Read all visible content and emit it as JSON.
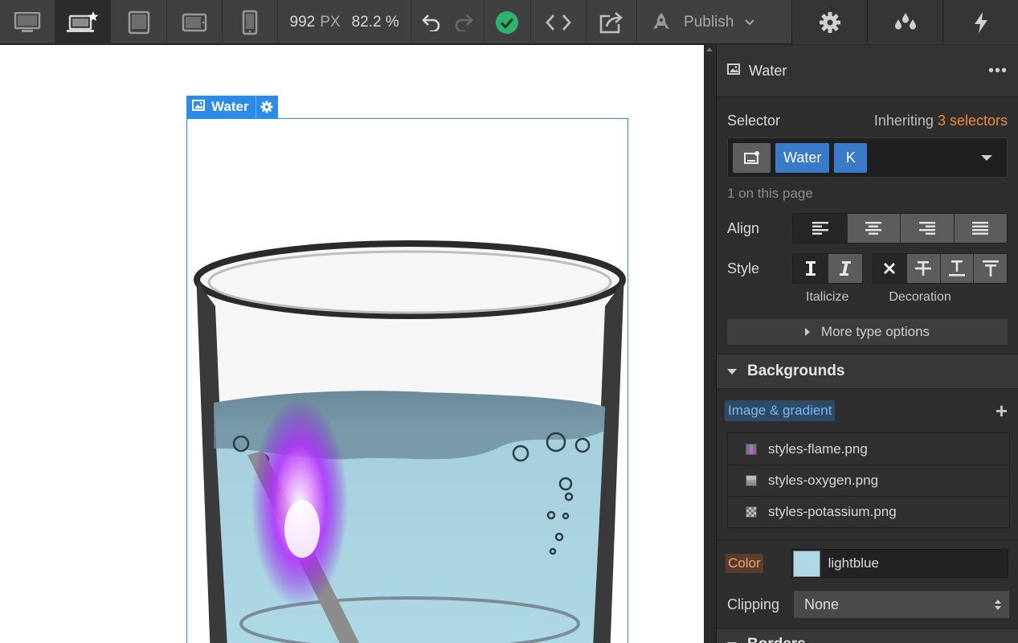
{
  "toolbar": {
    "width_value": "992",
    "width_unit": "PX",
    "zoom": "82.2 %",
    "publish_label": "Publish",
    "devices": [
      "desktop-icon",
      "laptop-star-icon",
      "tablet-landscape-icon",
      "tablet-icon",
      "phone-icon"
    ],
    "active_device": "laptop-star-icon",
    "status_color": "#2fb36b"
  },
  "canvas": {
    "selected_element_label": "Water"
  },
  "panel": {
    "element_name": "Water",
    "selector": {
      "label": "Selector",
      "inheriting_prefix": "Inheriting",
      "inheriting_count": "3 selectors",
      "chips": [
        "Water",
        "K"
      ],
      "on_page": "1 on this page"
    },
    "typography": {
      "align_label": "Align",
      "style_label": "Style",
      "italicize_label": "Italicize",
      "decoration_label": "Decoration",
      "more_label": "More type options"
    },
    "backgrounds": {
      "title": "Backgrounds",
      "image_gradient_label": "Image & gradient",
      "layers": [
        "styles-flame.png",
        "styles-oxygen.png",
        "styles-potassium.png"
      ],
      "color_label": "Color",
      "color_value": "lightblue",
      "color_hex": "#add8e6",
      "clipping_label": "Clipping",
      "clipping_value": "None"
    },
    "next_section_title": "Borders"
  }
}
